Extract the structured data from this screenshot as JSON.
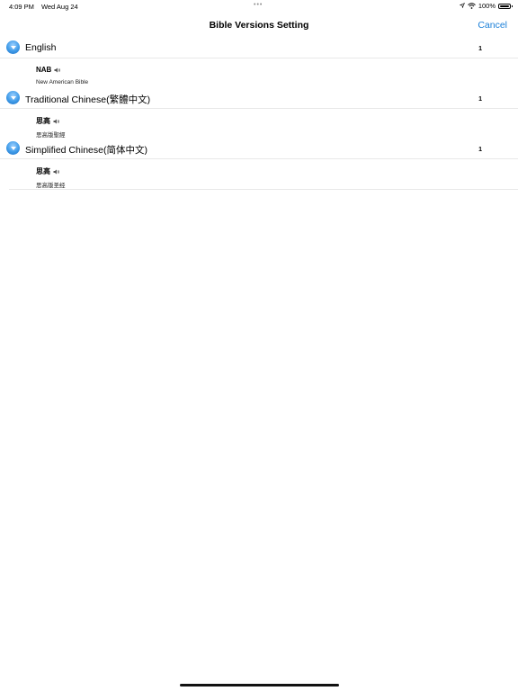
{
  "status_bar": {
    "time": "4:09 PM",
    "date": "Wed Aug 24",
    "dots": "•••",
    "battery_pct": "100%",
    "battery_level": 1.0
  },
  "nav": {
    "title": "Bible Versions Setting",
    "cancel_label": "Cancel"
  },
  "sections": [
    {
      "title": "English",
      "count": "1",
      "versions": [
        {
          "abbr": "NAB",
          "name": "New American Bible"
        }
      ]
    },
    {
      "title": "Traditional Chinese(繁體中文)",
      "count": "1",
      "versions": [
        {
          "abbr": "思高",
          "name": "思高版聖經"
        }
      ]
    },
    {
      "title": "Simplified Chinese(简体中文)",
      "count": "1",
      "versions": [
        {
          "abbr": "思高",
          "name": "思高版圣经"
        }
      ]
    }
  ],
  "icons": {
    "expand": "chevron-down-circle-icon",
    "speaker": "speaker-icon",
    "wifi": "wifi-icon",
    "battery": "battery-icon"
  },
  "colors": {
    "accent": "#1a7fd8",
    "separator": "#e8e8e8"
  }
}
